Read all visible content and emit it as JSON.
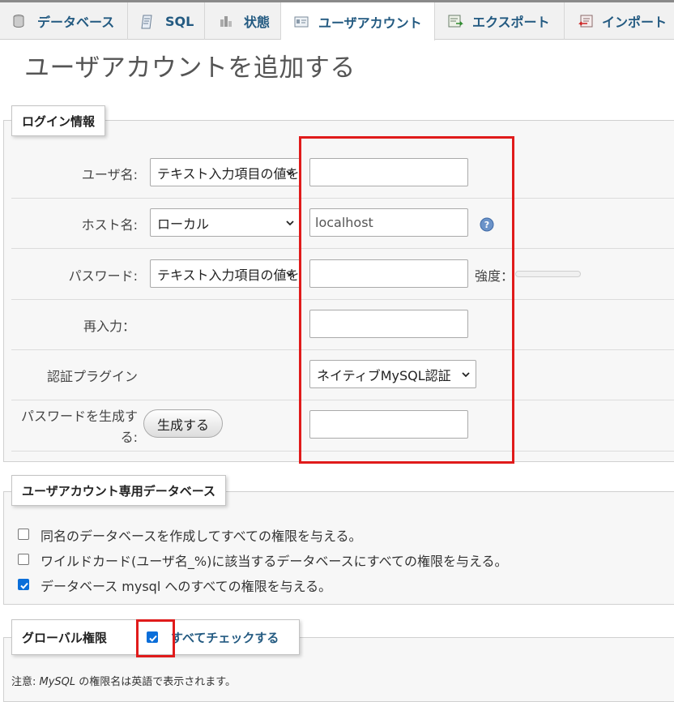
{
  "tabs": [
    {
      "label": "データベース",
      "icon": "database-icon"
    },
    {
      "label": "SQL",
      "icon": "sql-icon"
    },
    {
      "label": "状態",
      "icon": "status-icon"
    },
    {
      "label": "ユーザアカウント",
      "icon": "user-accounts-icon",
      "active": true
    },
    {
      "label": "エクスポート",
      "icon": "export-icon"
    },
    {
      "label": "インポート",
      "icon": "import-icon"
    }
  ],
  "page_title": "ユーザアカウントを追加する",
  "login": {
    "legend": "ログイン情報",
    "username_label": "ユーザ名:",
    "username_select": "テキスト入力項目の値を使用",
    "username_value": "",
    "host_label": "ホスト名:",
    "host_select": "ローカル",
    "host_value": "localhost",
    "password_label": "パスワード:",
    "password_select": "テキスト入力項目の値を使用",
    "password_value": "",
    "strength_label": "強度：",
    "strength_level": 0,
    "reenter_label": "再入力：",
    "reenter_value": "",
    "auth_label": "認証プラグイン",
    "auth_select": "ネイティブMySQL認証",
    "generate_label_1": "パスワードを生成す",
    "generate_label_2": "る:",
    "generate_button": "生成する",
    "generated_value": ""
  },
  "userdb": {
    "legend": "ユーザアカウント専用データベース",
    "options": [
      {
        "label": "同名のデータベースを作成してすべての権限を与える。",
        "checked": false
      },
      {
        "label": "ワイルドカード(ユーザ名_%)に該当するデータベースにすべての権限を与える。",
        "checked": false
      },
      {
        "label": "データベース mysql へのすべての権限を与える。",
        "checked": true
      }
    ]
  },
  "global": {
    "legend": "グローバル権限",
    "check_all_label": "すべてチェックする",
    "check_all_checked": true,
    "note_prefix": "注意: ",
    "note_mysql": "MySQL",
    "note_suffix": " の権限名は英語で表示されます。"
  },
  "colors": {
    "link": "#235a81",
    "annotation_red": "#e01b1b",
    "checkbox_blue": "#0b6ed9"
  }
}
